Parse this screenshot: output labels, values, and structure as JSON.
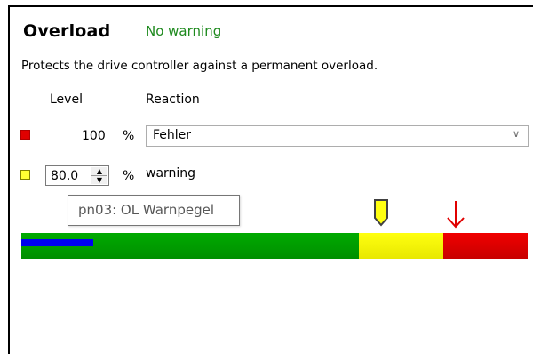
{
  "header": {
    "title": "Overload",
    "status": "No warning",
    "status_color": "#1e8a1e"
  },
  "description": "Protects the drive controller against a permanent overload.",
  "columns": {
    "level": "Level",
    "reaction": "Reaction"
  },
  "error_row": {
    "value": "100",
    "unit": "%",
    "reaction_selected": "Fehler",
    "color": "#e00000"
  },
  "warning_row": {
    "value": "80.0",
    "unit": "%",
    "label": "warning",
    "color": "#ffff33"
  },
  "tooltip": "pn03: OL Warnpegel",
  "gauge": {
    "max_percent": 120,
    "warning_level_percent": 80,
    "error_level_percent": 100,
    "current_load_percent": 17,
    "colors": {
      "normal": "#00a000",
      "warning": "#ffff00",
      "error": "#e00000",
      "load": "#0000f0"
    }
  }
}
